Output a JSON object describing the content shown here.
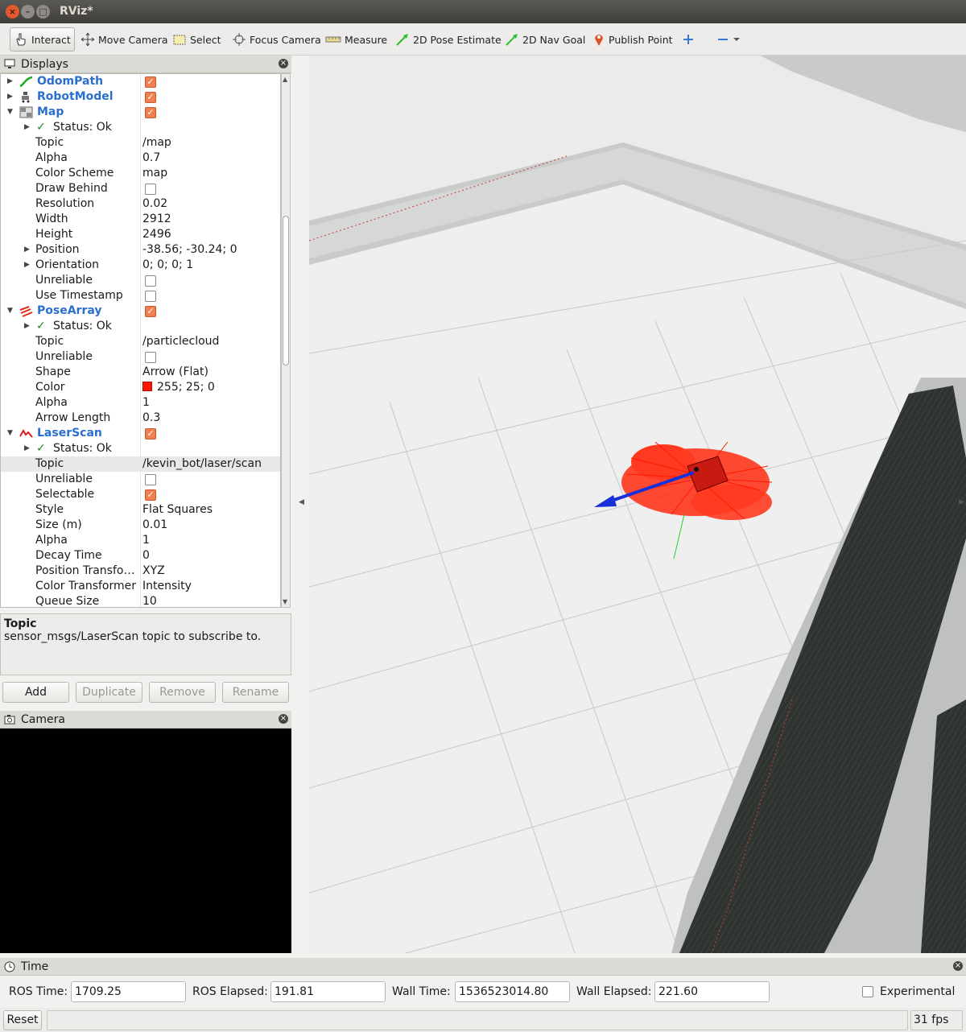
{
  "window": {
    "title": "RViz*"
  },
  "toolbar": {
    "tools": [
      {
        "label": "Interact",
        "icon": "hand-pointer-icon"
      },
      {
        "label": "Move Camera",
        "icon": "move-camera-icon"
      },
      {
        "label": "Select",
        "icon": "select-rectangle-icon"
      },
      {
        "label": "Focus Camera",
        "icon": "focus-target-icon"
      },
      {
        "label": "Measure",
        "icon": "ruler-icon"
      },
      {
        "label": "2D Pose Estimate",
        "icon": "green-arrow-icon"
      },
      {
        "label": "2D Nav Goal",
        "icon": "green-arrow-icon"
      },
      {
        "label": "Publish Point",
        "icon": "map-pin-icon"
      }
    ]
  },
  "displays": {
    "title": "Displays",
    "rows": [
      {
        "label": "OdomPath",
        "value": ""
      },
      {
        "label": "RobotModel",
        "value": ""
      },
      {
        "label": "Map",
        "value": ""
      },
      {
        "label": "Status: Ok",
        "value": ""
      },
      {
        "label": "Topic",
        "value": "/map"
      },
      {
        "label": "Alpha",
        "value": "0.7"
      },
      {
        "label": "Color Scheme",
        "value": "map"
      },
      {
        "label": "Draw Behind",
        "value": ""
      },
      {
        "label": "Resolution",
        "value": "0.02"
      },
      {
        "label": "Width",
        "value": "2912"
      },
      {
        "label": "Height",
        "value": "2496"
      },
      {
        "label": "Position",
        "value": "-38.56; -30.24; 0"
      },
      {
        "label": "Orientation",
        "value": "0; 0; 0; 1"
      },
      {
        "label": "Unreliable",
        "value": ""
      },
      {
        "label": "Use Timestamp",
        "value": ""
      },
      {
        "label": "PoseArray",
        "value": ""
      },
      {
        "label": "Status: Ok",
        "value": ""
      },
      {
        "label": "Topic",
        "value": "/particlecloud"
      },
      {
        "label": "Unreliable",
        "value": ""
      },
      {
        "label": "Shape",
        "value": "Arrow (Flat)"
      },
      {
        "label": "Color",
        "value": "255; 25; 0"
      },
      {
        "label": "Alpha",
        "value": "1"
      },
      {
        "label": "Arrow Length",
        "value": "0.3"
      },
      {
        "label": "LaserScan",
        "value": ""
      },
      {
        "label": "Status: Ok",
        "value": ""
      },
      {
        "label": "Topic",
        "value": "/kevin_bot/laser/scan"
      },
      {
        "label": "Unreliable",
        "value": ""
      },
      {
        "label": "Selectable",
        "value": ""
      },
      {
        "label": "Style",
        "value": "Flat Squares"
      },
      {
        "label": "Size (m)",
        "value": "0.01"
      },
      {
        "label": "Alpha",
        "value": "1"
      },
      {
        "label": "Decay Time",
        "value": "0"
      },
      {
        "label": "Position Transfo…",
        "value": "XYZ"
      },
      {
        "label": "Color Transformer",
        "value": "Intensity"
      },
      {
        "label": "Queue Size",
        "value": "10"
      }
    ],
    "colors": {
      "pose_array": "#ff1900"
    }
  },
  "description": {
    "title": "Topic",
    "text": "sensor_msgs/LaserScan topic to subscribe to."
  },
  "buttons": {
    "add": "Add",
    "duplicate": "Duplicate",
    "remove": "Remove",
    "rename": "Rename"
  },
  "camera": {
    "title": "Camera"
  },
  "time": {
    "title": "Time",
    "ros_time_label": "ROS Time:",
    "ros_time": "1709.25",
    "ros_elapsed_label": "ROS Elapsed:",
    "ros_elapsed": "191.81",
    "wall_time_label": "Wall Time:",
    "wall_time": "1536523014.80",
    "wall_elapsed_label": "Wall Elapsed:",
    "wall_elapsed": "221.60",
    "experimental_label": "Experimental"
  },
  "status": {
    "reset": "Reset",
    "fps": "31 fps"
  }
}
